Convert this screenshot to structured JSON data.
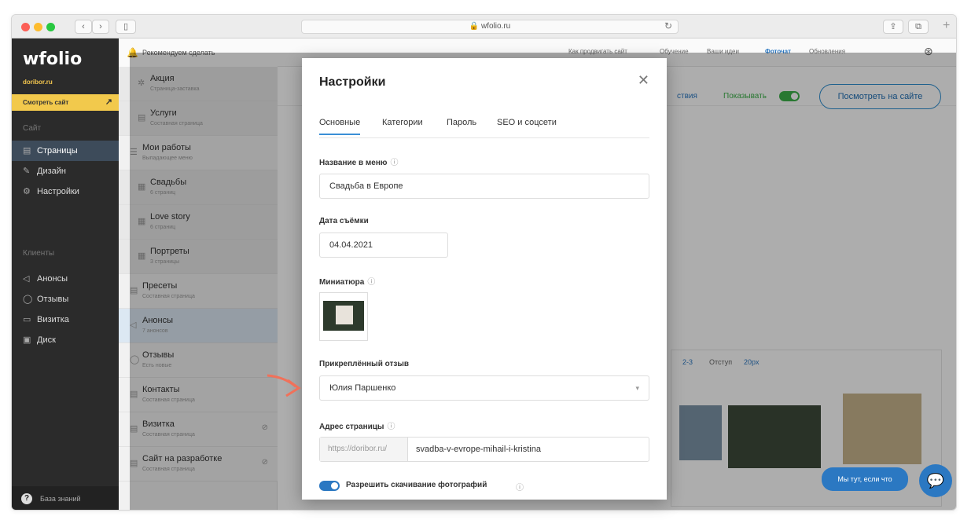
{
  "browser": {
    "url": "wfolio.ru",
    "back": "‹",
    "forward": "›",
    "sidebar_toggle": "▯",
    "reload": "↻",
    "share": "⇪",
    "tabs": "⧉",
    "newtab": "+"
  },
  "sidebar": {
    "logo": "wfolio",
    "site": "doribor.ru",
    "view_site": "Смотреть сайт",
    "section_site": "Сайт",
    "section_clients": "Клиенты",
    "items": [
      {
        "label": "Страницы",
        "icon": "page-icon"
      },
      {
        "label": "Дизайн",
        "icon": "brush-icon"
      },
      {
        "label": "Настройки",
        "icon": "gear-icon"
      },
      {
        "label": "Анонсы",
        "icon": "megaphone-icon"
      },
      {
        "label": "Отзывы",
        "icon": "chat-icon"
      },
      {
        "label": "Визитка",
        "icon": "card-icon"
      },
      {
        "label": "Диск",
        "icon": "disk-icon"
      }
    ],
    "knowledge_base": "База знаний"
  },
  "pages_list": {
    "recommend": "Рекомендуем сделать",
    "items": [
      {
        "title": "Акция",
        "subtitle": "Страница-заставка"
      },
      {
        "title": "Услуги",
        "subtitle": "Составная страница"
      },
      {
        "title": "Мои работы",
        "subtitle": "Выпадающее меню"
      },
      {
        "title": "Свадьбы",
        "subtitle": "6 страниц"
      },
      {
        "title": "Love story",
        "subtitle": "6 страниц"
      },
      {
        "title": "Портреты",
        "subtitle": "3 страницы"
      },
      {
        "title": "Пресеты",
        "subtitle": "Составная страница"
      },
      {
        "title": "Анонсы",
        "subtitle": "7 анонсов"
      },
      {
        "title": "Отзывы",
        "subtitle": "Есть новые"
      },
      {
        "title": "Контакты",
        "subtitle": "Составная страница"
      },
      {
        "title": "Визитка",
        "subtitle": "Составная страница"
      },
      {
        "title": "Сайт на разработке",
        "subtitle": "Составная страница"
      }
    ]
  },
  "topbar": {
    "promo": "Как продвигать сайт",
    "learning": "Обучение",
    "ideas": "Ваши идеи",
    "photochat": "Фоточат",
    "updates": "Обновления"
  },
  "actions": {
    "actions_label": "ствия",
    "show_label": "Показывать",
    "view_on_site": "Посмотреть на сайте",
    "gallery_cols": "2-3",
    "gallery_indent_label": "Отступ",
    "gallery_indent_value": "20px"
  },
  "chat": {
    "bubble_text": "Мы тут, если что"
  },
  "modal": {
    "title": "Настройки",
    "close": "✕",
    "tabs": [
      "Основные",
      "Категории",
      "Пароль",
      "SEO и соцсети"
    ],
    "menu_name_label": "Название в меню",
    "menu_name_value": "Свадьба в Европе",
    "shoot_date_label": "Дата съёмки",
    "shoot_date_value": "04.04.2021",
    "thumbnail_label": "Миниатюра",
    "review_label": "Прикреплённый отзыв",
    "review_value": "Юлия Паршенко",
    "address_label": "Адрес страницы",
    "address_prefix": "https://doribor.ru/",
    "address_value": "svadba-v-evrope-mihail-i-kristina",
    "allow_download_label": "Разрешить скачивание фотографий"
  },
  "colors": {
    "accent": "#3a8fd6",
    "sidebar_bg": "#2b2b2b",
    "site_yellow": "#f2c94c",
    "toggle_green": "#3db24a",
    "arrow_red": "#f0715a"
  }
}
